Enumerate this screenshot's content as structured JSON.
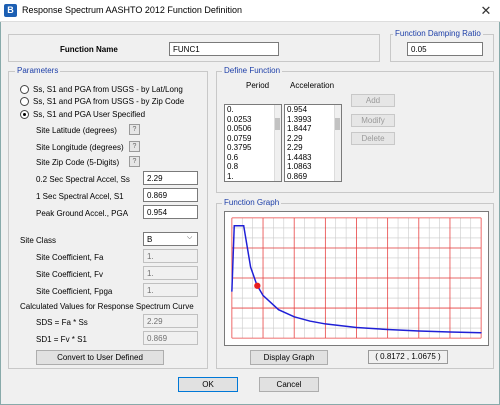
{
  "window": {
    "title": "Response Spectrum AASHTO 2012 Function Definition",
    "icon": "etabs-b-icon",
    "icon_letter": "B"
  },
  "function_name": {
    "label": "Function Name",
    "value": "FUNC1"
  },
  "damping": {
    "title": "Function Damping Ratio",
    "value": "0.05"
  },
  "parameters": {
    "title": "Parameters",
    "options": [
      {
        "label": "Ss, S1 and PGA from USGS - by Lat/Long",
        "selected": false
      },
      {
        "label": "Ss, S1 and PGA from USGS - by Zip Code",
        "selected": false
      },
      {
        "label": "Ss, S1 and PGA User Specified",
        "selected": true
      }
    ],
    "latitude_label": "Site Latitude (degrees)",
    "longitude_label": "Site Longitude (degrees)",
    "zip_label": "Site Zip Code (5-Digits)",
    "question_mark": "?",
    "ss_label": "0.2 Sec Spectral Accel, Ss",
    "ss_value": "2.29",
    "s1_label": "1 Sec Spectral Accel, S1",
    "s1_value": "0.869",
    "pga_label": "Peak Ground Accel., PGA",
    "pga_value": "0.954",
    "site_class_label": "Site Class",
    "site_class_value": "B",
    "fa_label": "Site Coefficient, Fa",
    "fa_value": "1.",
    "fv_label": "Site Coefficient, Fv",
    "fv_value": "1.",
    "fpga_label": "Site Coefficient, Fpga",
    "fpga_value": "1.",
    "calc_label": "Calculated Values for Response Spectrum Curve",
    "sds_label": "SDS = Fa * Ss",
    "sds_value": "2.29",
    "sd1_label": "SD1 = Fv * S1",
    "sd1_value": "0.869",
    "convert_button": "Convert to User Defined"
  },
  "define_function": {
    "title": "Define Function",
    "period_header": "Period",
    "accel_header": "Acceleration",
    "periods": [
      "0.",
      "0.0253",
      "0.0506",
      "0.0759",
      "0.3795",
      "0.6",
      "0.8",
      "1."
    ],
    "accels": [
      "0.954",
      "1.3993",
      "1.8447",
      "2.29",
      "2.29",
      "1.4483",
      "1.0863",
      "0.869"
    ],
    "add_button": "Add",
    "modify_button": "Modify",
    "delete_button": "Delete"
  },
  "graph": {
    "title": "Function Graph",
    "display_button": "Display Graph",
    "coordinate_readout": "( 0.8172 , 1.0675 )",
    "curve_color": "#1f1fd6",
    "marker_color": "#e81e1e",
    "grid_color": "#e84040",
    "grid_color_light": "#c9c9c9"
  },
  "chart_data": {
    "type": "line",
    "title": "",
    "xlabel": "",
    "ylabel": "",
    "x": [
      0,
      0.0253,
      0.0506,
      0.0759,
      0.3795,
      0.6,
      0.8,
      1.0,
      1.5,
      2.0,
      2.5,
      3.0,
      4.0,
      5.0,
      6.0,
      7.0,
      8.0
    ],
    "series": [
      {
        "values": [
          0.954,
          1.3993,
          1.8447,
          2.29,
          2.29,
          1.4483,
          1.0863,
          0.869,
          0.5793,
          0.4345,
          0.3476,
          0.2897,
          0.2173,
          0.1738,
          0.1448,
          0.1241,
          0.1086
        ]
      }
    ],
    "marker": {
      "x": 0.8172,
      "y": 1.0675
    },
    "xlim": [
      0,
      8
    ],
    "ylim": [
      0,
      2.45
    ],
    "grid": true,
    "legend": "none"
  },
  "buttons": {
    "ok": "OK",
    "cancel": "Cancel"
  }
}
